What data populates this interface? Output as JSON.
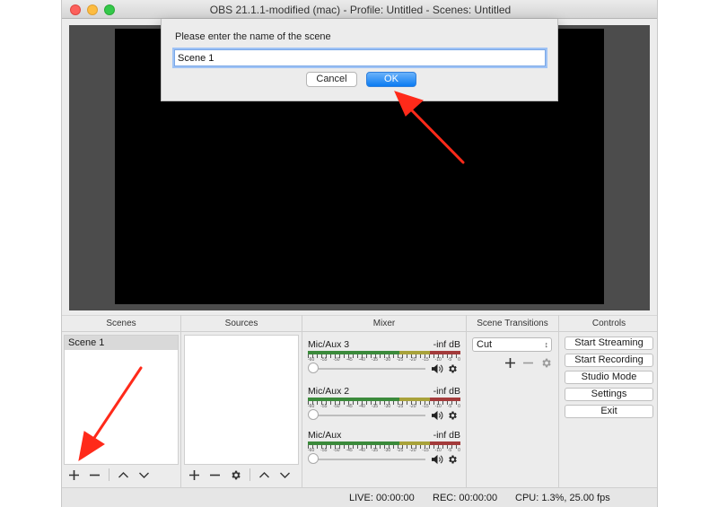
{
  "window": {
    "title": "OBS 21.1.1-modified (mac) - Profile: Untitled - Scenes: Untitled"
  },
  "dialog": {
    "prompt": "Please enter the name of the scene",
    "input_value": "Scene 1",
    "cancel_label": "Cancel",
    "ok_label": "OK"
  },
  "docks": {
    "scenes": {
      "title": "Scenes",
      "items": [
        "Scene 1"
      ]
    },
    "sources": {
      "title": "Sources"
    },
    "mixer": {
      "title": "Mixer",
      "channels": [
        {
          "name": "Mic/Aux 3",
          "level": "-inf dB"
        },
        {
          "name": "Mic/Aux 2",
          "level": "-inf dB"
        },
        {
          "name": "Mic/Aux",
          "level": "-inf dB"
        }
      ],
      "tick_labels": [
        "-60",
        "-55",
        "-50",
        "-45",
        "-40",
        "-35",
        "-30",
        "-25",
        "-20",
        "-15",
        "-10",
        "-5",
        "0"
      ]
    },
    "transitions": {
      "title": "Scene Transitions",
      "selected": "Cut"
    },
    "controls": {
      "title": "Controls",
      "buttons": [
        "Start Streaming",
        "Start Recording",
        "Studio Mode",
        "Settings",
        "Exit"
      ]
    }
  },
  "status": {
    "live": "LIVE: 00:00:00",
    "rec": "REC: 00:00:00",
    "cpu": "CPU: 1.3%, 25.00 fps"
  },
  "icons": {
    "add": "plus-icon",
    "remove": "minus-icon",
    "move_up": "chevron-up-icon",
    "move_down": "chevron-down-icon",
    "settings": "gear-icon",
    "mute": "speaker-icon"
  },
  "colors": {
    "accent": "#0a7bf2",
    "annotation_arrow": "#ff2a1a"
  }
}
